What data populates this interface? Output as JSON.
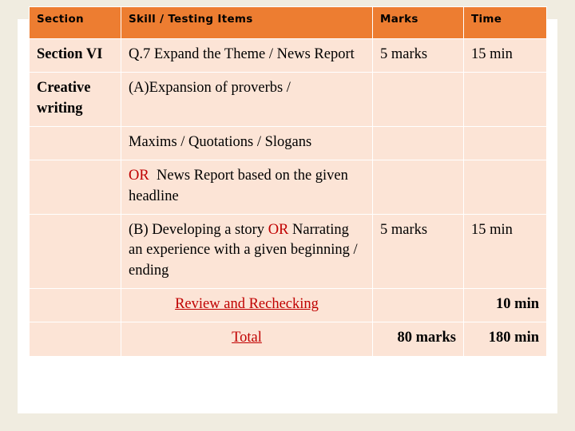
{
  "slide": {
    "background_color": "#f0ece0",
    "panel_color": "#ffffff"
  },
  "table": {
    "header_bg": "#ed7d31",
    "cell_bg": "#fce4d6",
    "accent_red": "#c00000",
    "columns": [
      {
        "key": "section",
        "label": "Section"
      },
      {
        "key": "skill",
        "label": "Skill / Testing Items"
      },
      {
        "key": "marks",
        "label": "Marks"
      },
      {
        "key": "time",
        "label": "Time"
      }
    ],
    "rows": [
      {
        "section": "Section VI",
        "skill": "Q.7 Expand the Theme / News Report",
        "marks": "5 marks",
        "time": "15 min"
      },
      {
        "section": "Creative writing",
        "skill": "(A)Expansion of proverbs /",
        "marks": "",
        "time": ""
      },
      {
        "section": "",
        "skill": "Maxims / Quotations / Slogans",
        "marks": "",
        "time": ""
      },
      {
        "section": "",
        "skill_or": "OR",
        "skill": "News Report based on the given headline",
        "marks": "",
        "time": ""
      },
      {
        "section": "",
        "skill_pre": "(B) Developing a story",
        "skill_or": "OR",
        "skill_post": "Narrating an experience with a given beginning / ending",
        "marks": "5 marks",
        "time": "15 min"
      },
      {
        "section": "",
        "skill": "Review and Rechecking",
        "marks": "",
        "time": "10 min"
      },
      {
        "section": "",
        "skill": "Total",
        "marks": "80 marks",
        "time": "180 min"
      }
    ]
  }
}
